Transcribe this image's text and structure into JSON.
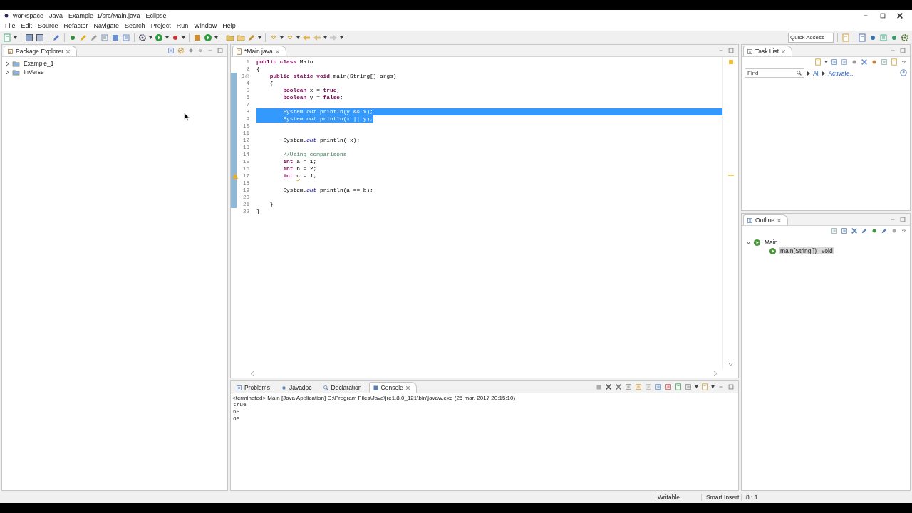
{
  "window": {
    "title": "workspace - Java - Example_1/src/Main.java - Eclipse"
  },
  "menu": [
    "File",
    "Edit",
    "Source",
    "Refactor",
    "Navigate",
    "Search",
    "Project",
    "Run",
    "Window",
    "Help"
  ],
  "quick_access": {
    "placeholder": "Quick Access"
  },
  "package_explorer": {
    "title": "Package Explorer",
    "items": [
      {
        "label": "Example_1",
        "expanded": false
      },
      {
        "label": "InVerse",
        "expanded": false
      }
    ]
  },
  "editor": {
    "tab": "*Main.java",
    "lines": [
      {
        "number": "1",
        "changed": false,
        "fold": false,
        "warning": false,
        "selected": false,
        "segments": [
          {
            "kind": "keyword",
            "text": "public class"
          },
          {
            "kind": "plain",
            "text": " Main"
          }
        ]
      },
      {
        "number": "2",
        "changed": false,
        "fold": false,
        "warning": false,
        "selected": false,
        "segments": [
          {
            "kind": "plain",
            "text": "{"
          }
        ]
      },
      {
        "number": "3",
        "changed": true,
        "fold": true,
        "warning": false,
        "selected": false,
        "segments": [
          {
            "kind": "keyword",
            "text": "    public static void"
          },
          {
            "kind": "plain",
            "text": " main(String[] args)"
          }
        ]
      },
      {
        "number": "4",
        "changed": true,
        "fold": false,
        "warning": false,
        "selected": false,
        "segments": [
          {
            "kind": "plain",
            "text": "    {"
          }
        ]
      },
      {
        "number": "5",
        "changed": true,
        "fold": false,
        "warning": false,
        "selected": false,
        "segments": [
          {
            "kind": "keyword",
            "text": "        boolean"
          },
          {
            "kind": "plain",
            "text": " x = "
          },
          {
            "kind": "keyword",
            "text": "true"
          },
          {
            "kind": "plain",
            "text": ";"
          }
        ]
      },
      {
        "number": "6",
        "changed": true,
        "fold": false,
        "warning": false,
        "selected": false,
        "segments": [
          {
            "kind": "keyword",
            "text": "        boolean"
          },
          {
            "kind": "plain",
            "text": " y = "
          },
          {
            "kind": "keyword",
            "text": "false"
          },
          {
            "kind": "plain",
            "text": ";"
          }
        ]
      },
      {
        "number": "7",
        "changed": true,
        "fold": false,
        "warning": false,
        "selected": false
      },
      {
        "number": "8",
        "changed": true,
        "fold": false,
        "warning": false,
        "selected": true,
        "segments": [
          {
            "kind": "plain",
            "text": "        System."
          },
          {
            "kind": "field",
            "text": "out"
          },
          {
            "kind": "plain",
            "text": ".println(y && x);"
          }
        ]
      },
      {
        "number": "9",
        "changed": true,
        "fold": false,
        "warning": false,
        "selected": true,
        "segments": [
          {
            "kind": "plain",
            "text": "        System."
          },
          {
            "kind": "field",
            "text": "out"
          },
          {
            "kind": "plain",
            "text": ".println(x || y);"
          }
        ]
      },
      {
        "number": "10",
        "changed": true,
        "fold": false,
        "warning": false,
        "selected": false
      },
      {
        "number": "11",
        "changed": true,
        "fold": false,
        "warning": false,
        "selected": false
      },
      {
        "number": "12",
        "changed": true,
        "fold": false,
        "warning": false,
        "selected": false,
        "segments": [
          {
            "kind": "plain",
            "text": "        System."
          },
          {
            "kind": "field",
            "text": "out"
          },
          {
            "kind": "plain",
            "text": ".println(!x);"
          }
        ]
      },
      {
        "number": "13",
        "changed": true,
        "fold": false,
        "warning": false,
        "selected": false
      },
      {
        "number": "14",
        "changed": true,
        "fold": false,
        "warning": false,
        "selected": false,
        "segments": [
          {
            "kind": "comment",
            "text": "        //Using comparisons"
          }
        ]
      },
      {
        "number": "15",
        "changed": true,
        "fold": false,
        "warning": false,
        "selected": false,
        "segments": [
          {
            "kind": "keyword",
            "text": "        int"
          },
          {
            "kind": "plain",
            "text": " a = 1;"
          }
        ]
      },
      {
        "number": "16",
        "changed": true,
        "fold": false,
        "warning": false,
        "selected": false,
        "segments": [
          {
            "kind": "keyword",
            "text": "        int"
          },
          {
            "kind": "plain",
            "text": " b = 2;"
          }
        ]
      },
      {
        "number": "17",
        "changed": true,
        "fold": false,
        "warning": true,
        "selected": false,
        "segments": [
          {
            "kind": "keyword",
            "text": "        int "
          },
          {
            "kind": "unused",
            "text": "c"
          },
          {
            "kind": "plain",
            "text": " = 1;"
          }
        ]
      },
      {
        "number": "18",
        "changed": true,
        "fold": false,
        "warning": false,
        "selected": false
      },
      {
        "number": "19",
        "changed": true,
        "fold": false,
        "warning": false,
        "selected": false,
        "segments": [
          {
            "kind": "plain",
            "text": "        System."
          },
          {
            "kind": "field",
            "text": "out"
          },
          {
            "kind": "plain",
            "text": ".println(a == b);"
          }
        ]
      },
      {
        "number": "20",
        "changed": true,
        "fold": false,
        "warning": false,
        "selected": false
      },
      {
        "number": "21",
        "changed": true,
        "fold": false,
        "warning": false,
        "selected": false,
        "segments": [
          {
            "kind": "plain",
            "text": "    }"
          }
        ]
      },
      {
        "number": "22",
        "changed": false,
        "fold": false,
        "warning": false,
        "selected": false,
        "segments": [
          {
            "kind": "plain",
            "text": "}"
          }
        ]
      }
    ]
  },
  "console": {
    "tabs": [
      {
        "label": "Problems",
        "selected": false
      },
      {
        "label": "Javadoc",
        "selected": false
      },
      {
        "label": "Declaration",
        "selected": false
      },
      {
        "label": "Console",
        "selected": true
      }
    ],
    "description": "<terminated> Main [Java Application] C:\\Program Files\\Java\\jre1.8.0_121\\bin\\javaw.exe (25 mar. 2017 20:15:10)",
    "output": [
      "true",
      "65",
      "65"
    ]
  },
  "task_list": {
    "title": "Task List",
    "find": {
      "placeholder": "Find"
    },
    "links": [
      "All",
      "Activate..."
    ]
  },
  "outline": {
    "title": "Outline",
    "items": [
      {
        "label": "Main",
        "expanded": true,
        "selected": false,
        "children": [
          {
            "label": "main(String[]) : void",
            "selected": true
          }
        ]
      }
    ]
  },
  "status_bar": [
    "Writable",
    "Smart Insert",
    "8 : 1"
  ]
}
